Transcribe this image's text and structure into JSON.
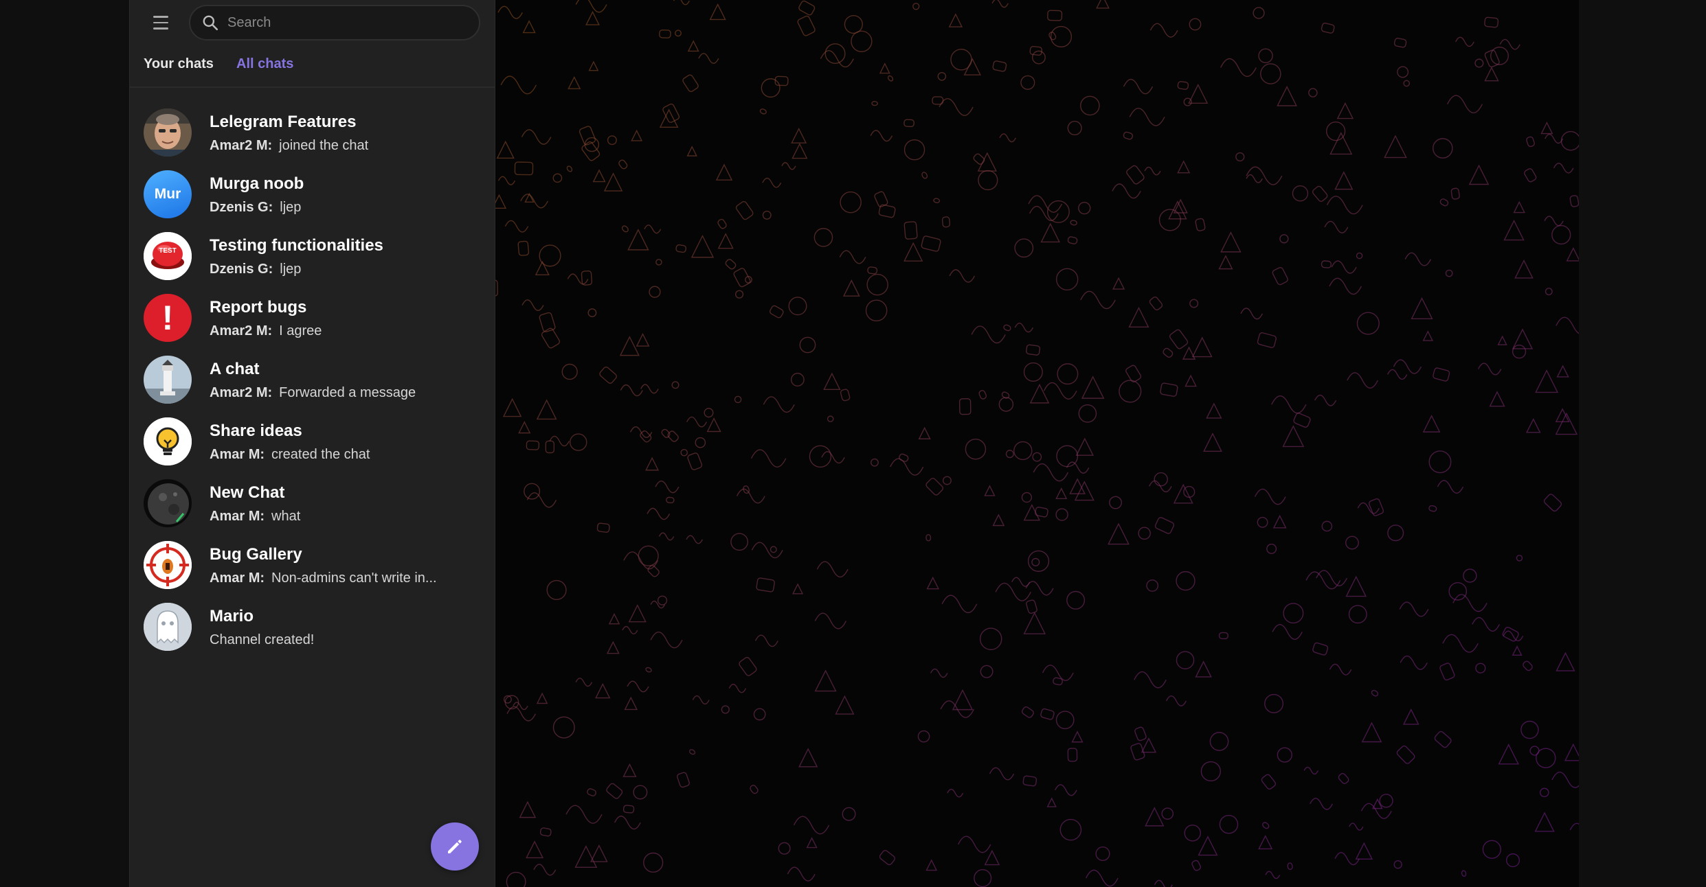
{
  "search": {
    "placeholder": "Search"
  },
  "tabs": [
    {
      "label": "Your chats",
      "active": false
    },
    {
      "label": "All chats",
      "active": true
    }
  ],
  "colors": {
    "accent": "#8774e1",
    "sidebar_bg": "#212121",
    "main_bg": "#050505"
  },
  "chats": [
    {
      "title": "Lelegram Features",
      "sender": "Amar2 M:",
      "preview": "joined the chat",
      "avatar_icon": "person-photo"
    },
    {
      "title": "Murga noob",
      "sender": "Dzenis G:",
      "preview": "ljep",
      "avatar_icon": "initials",
      "avatar_text": "Mur",
      "avatar_color": "#2f8ff0"
    },
    {
      "title": "Testing functionalities",
      "sender": "Dzenis G:",
      "preview": "ljep",
      "avatar_icon": "test-button",
      "avatar_text": "TEST"
    },
    {
      "title": "Report bugs",
      "sender": "Amar2 M:",
      "preview": "I agree",
      "avatar_icon": "exclamation",
      "avatar_text": "!"
    },
    {
      "title": "A chat",
      "sender": "Amar2 M:",
      "preview": "Forwarded a message",
      "avatar_icon": "lighthouse"
    },
    {
      "title": "Share ideas",
      "sender": "Amar M:",
      "preview": "created the chat",
      "avatar_icon": "lightbulb"
    },
    {
      "title": "New Chat",
      "sender": "Amar M:",
      "preview": "what",
      "avatar_icon": "planet"
    },
    {
      "title": "Bug Gallery",
      "sender": "Amar M:",
      "preview": "Non-admins can't write in...",
      "avatar_icon": "bug-target"
    },
    {
      "title": "Mario",
      "sender": "",
      "preview": "Channel created!",
      "avatar_icon": "ghost"
    }
  ],
  "fab": {
    "icon": "pencil-icon"
  },
  "main": {
    "background": "doodle-pattern"
  }
}
